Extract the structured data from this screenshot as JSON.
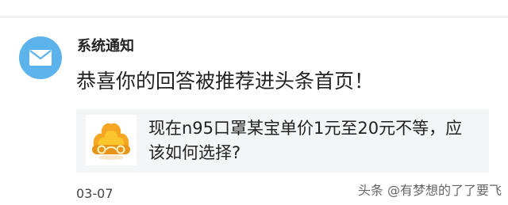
{
  "notification": {
    "avatar_icon": "mail-icon",
    "avatar_color": "#5cb2ea",
    "sender": "系统通知",
    "headline": "恭喜你的回答被推荐进头条首页！",
    "card": {
      "thumbnail_icon": "golden-crown-logo-icon",
      "question": "现在n95口罩某宝单价1元至20元不等，应该如何选择?"
    },
    "date": "03-07"
  },
  "watermark": "头条 @有梦想的了了要飞"
}
